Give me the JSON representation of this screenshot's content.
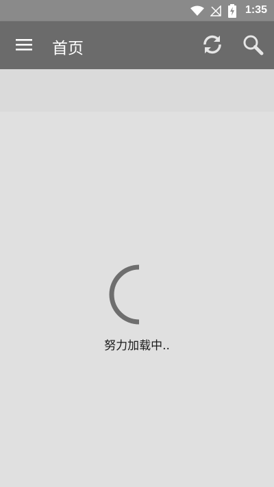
{
  "status_bar": {
    "time": "1:35",
    "icons": [
      "wifi-icon",
      "no-signal-icon",
      "battery-charging-icon"
    ]
  },
  "app_bar": {
    "menu_icon": "menu-icon",
    "title": "首页",
    "actions": [
      "refresh-icon",
      "search-icon"
    ]
  },
  "loading": {
    "text": "努力加载中.."
  },
  "colors": {
    "status_bar": "#8a8a8a",
    "app_bar": "#6b6b6b",
    "background": "#e0e0e0",
    "spinner": "#6e6e6e"
  }
}
